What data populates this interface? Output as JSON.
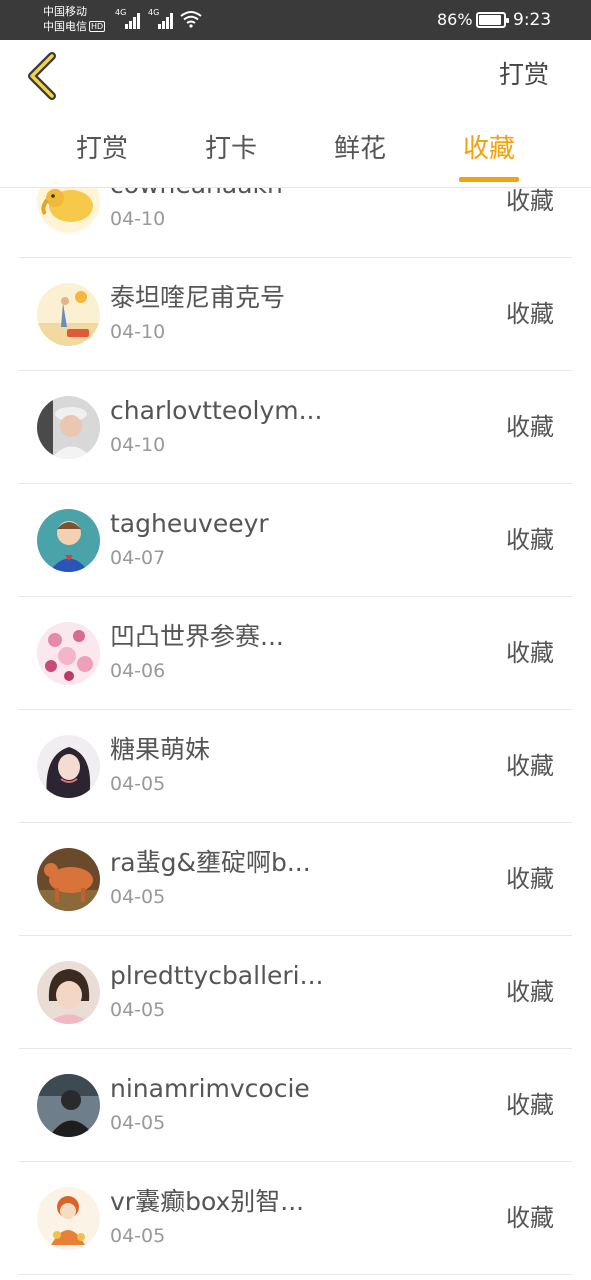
{
  "status_bar": {
    "carrier1": "中国移动",
    "carrier2": "中国电信",
    "hd_badge": "HD",
    "network1": "4G",
    "network2": "4G",
    "battery_percent": "86%",
    "time": "9:23"
  },
  "header": {
    "back_icon": "chevron-left-icon",
    "action_label": "打赏"
  },
  "tabs": [
    {
      "label": "打赏",
      "active": false
    },
    {
      "label": "打卡",
      "active": false
    },
    {
      "label": "鲜花",
      "active": false
    },
    {
      "label": "收藏",
      "active": true
    }
  ],
  "colors": {
    "accent": "#f5a00c",
    "status_bar": "#3a3a3a"
  },
  "list": {
    "items": [
      {
        "name": "cowheahaakh",
        "date": "04-10",
        "action": "收藏"
      },
      {
        "name": "泰坦喹尼甫克号",
        "date": "04-10",
        "action": "收藏"
      },
      {
        "name": "charlovtteolym...",
        "date": "04-10",
        "action": "收藏"
      },
      {
        "name": "tagheuveeyr",
        "date": "04-07",
        "action": "收藏"
      },
      {
        "name": "凹凸世界参赛...",
        "date": "04-06",
        "action": "收藏"
      },
      {
        "name": "糖果萌妹",
        "date": "04-05",
        "action": "收藏"
      },
      {
        "name": "ra蜚g&壅碇啊b...",
        "date": "04-05",
        "action": "收藏"
      },
      {
        "name": "plredttycballeri...",
        "date": "04-05",
        "action": "收藏"
      },
      {
        "name": "ninamrimvcocie",
        "date": "04-05",
        "action": "收藏"
      },
      {
        "name": "vr囊癫box别智...",
        "date": "04-05",
        "action": "收藏"
      }
    ]
  }
}
